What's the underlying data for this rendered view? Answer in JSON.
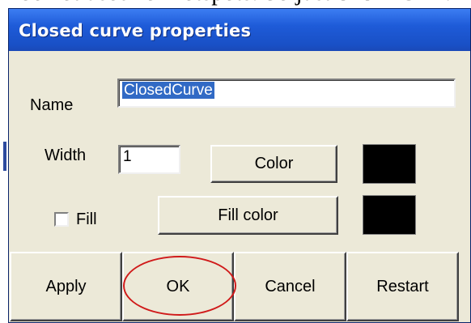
{
  "background": {
    "caption_fragment": "be not used for hotspots. So just click \"OK\"."
  },
  "dialog": {
    "title": "Closed curve properties",
    "name_label": "Name",
    "name_value": "ClosedCurve",
    "width_label": "Width",
    "width_value": "1",
    "color_button": "Color",
    "fill_label": "Fill",
    "fill_checked": false,
    "fill_color_button": "Fill color",
    "color_swatch": "#000000",
    "fill_color_swatch": "#000000",
    "buttons": {
      "apply": "Apply",
      "ok": "OK",
      "cancel": "Cancel",
      "restart": "Restart"
    }
  },
  "colors": {
    "title_bar": "#1e5bd8",
    "dialog_face": "#ece9d8",
    "selection": "#316ac5",
    "annotation_circle": "#d01a1a"
  }
}
